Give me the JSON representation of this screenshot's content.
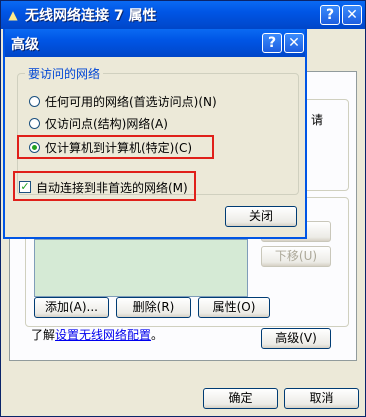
{
  "window": {
    "title": "无线网络连接 7 属性",
    "help_glyph": "?",
    "close_glyph": "✕",
    "ok_label": "确定",
    "cancel_label": "取消"
  },
  "background": {
    "partial_text_right": "请",
    "move_down_label": "下移(U)",
    "add_label": "添加(A)...",
    "delete_label": "删除(R)",
    "properties_label": "属性(O)",
    "learn_prefix": "了解",
    "learn_link": "设置无线网络配置",
    "learn_suffix": "。",
    "advanced_label": "高级(V)"
  },
  "dialog": {
    "title": "高级",
    "help_glyph": "?",
    "close_glyph": "✕",
    "group_label": "要访问的网络",
    "options": [
      {
        "label": "任何可用的网络(首选访问点)(N)",
        "selected": false
      },
      {
        "label": "仅访问点(结构)网络(A)",
        "selected": false
      },
      {
        "label": "仅计算机到计算机(特定)(C)",
        "selected": true
      }
    ],
    "auto_connect_label": "自动连接到非首选的网络(M)",
    "auto_connect_checked": true,
    "checkmark_glyph": "✓",
    "close_button_label": "关闭"
  },
  "colors": {
    "titlebar": "#0055e5",
    "highlight": "#e0201a",
    "group_label": "#0046d5",
    "link": "#0000ee"
  }
}
